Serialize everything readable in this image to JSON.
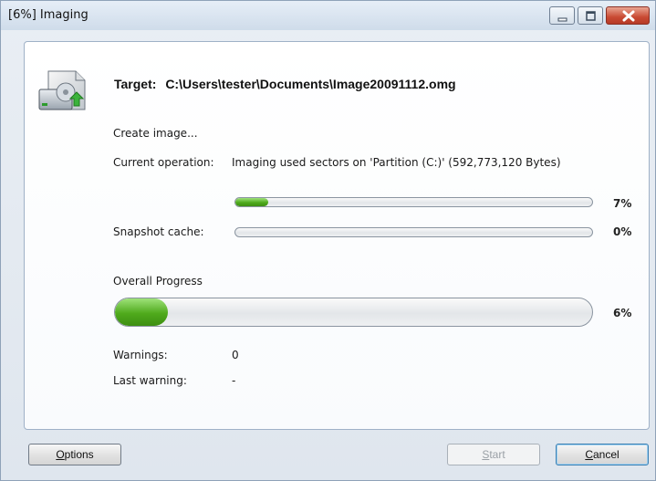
{
  "window": {
    "title": "[6%] Imaging"
  },
  "header": {
    "target_label": "Target:",
    "target_path": "C:\\Users\\tester\\Documents\\Image20091112.omg"
  },
  "status": {
    "heading": "Create image...",
    "current_operation_label": "Current operation:",
    "current_operation_value": "Imaging used sectors on 'Partition (C:)' (592,773,120 Bytes)"
  },
  "progress": {
    "operation": {
      "value": 0.07,
      "label": "7%"
    },
    "snapshot": {
      "label_text": "Snapshot cache:",
      "value": 0.0,
      "label": "0%"
    },
    "overall": {
      "label_text": "Overall Progress",
      "value": 0.06,
      "label": "6%"
    }
  },
  "info": {
    "warnings_label": "Warnings:",
    "warnings_value": "0",
    "last_warning_label": "Last warning:",
    "last_warning_value": "-"
  },
  "buttons": {
    "options_mnemonic": "O",
    "options_rest": "ptions",
    "start_mnemonic": "S",
    "start_rest": "tart",
    "cancel_mnemonic": "C",
    "cancel_rest": "ancel"
  },
  "icons": {
    "app": "disk-imaging-icon",
    "minimize": "minimize-icon",
    "maximize": "maximize-icon",
    "close": "close-icon"
  },
  "colors": {
    "progress_fill": "#4faa1c",
    "close_button": "#c94a33",
    "panel_border": "#9fb1c7"
  }
}
